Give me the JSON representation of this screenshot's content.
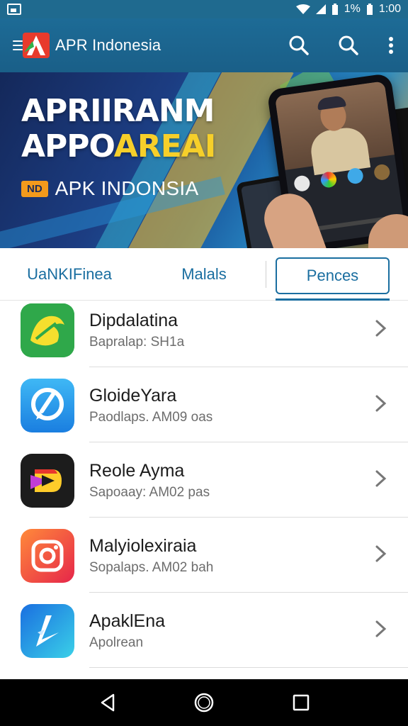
{
  "status_bar": {
    "battery_text": "1%",
    "time": "1:00"
  },
  "app_bar": {
    "title": "APR Indonesia",
    "actions": [
      "search-icon",
      "search-icon",
      "more-vert-icon"
    ]
  },
  "banner": {
    "headline_line1": "APRIIRANM",
    "headline_line2_a": "APPO",
    "headline_line2_b": "AREAI",
    "badge": "ND",
    "subtitle": "APK INDONSIA"
  },
  "tabs": [
    {
      "label": "UaNKIFinea",
      "selected": false
    },
    {
      "label": "Malals",
      "selected": false
    },
    {
      "label": "Pences",
      "selected": true
    }
  ],
  "apps": [
    {
      "name": "Dipdalatina",
      "subtitle": "Bapralap: SH1a",
      "icon": "leaf-icon",
      "color": "#2fa84a"
    },
    {
      "name": "GloideYara",
      "subtitle": "Paodlaps. AM09 oas",
      "icon": "search-bubble-icon",
      "color": "#1e90e8"
    },
    {
      "name": "Reole Ayma",
      "subtitle": "Sapoaay: AM02 pas",
      "icon": "play-d-icon",
      "color": "#1c1c1c"
    },
    {
      "name": "Malyiolexiraia",
      "subtitle": "Sopalaps. AM02 bah",
      "icon": "camera-icon",
      "color": "#f04a3a"
    },
    {
      "name": "ApaklEna",
      "subtitle": "Apolrean",
      "icon": "arrow-play-icon",
      "color": "#2a7fe0"
    }
  ],
  "nav": [
    "back-icon",
    "home-icon",
    "recents-icon"
  ]
}
